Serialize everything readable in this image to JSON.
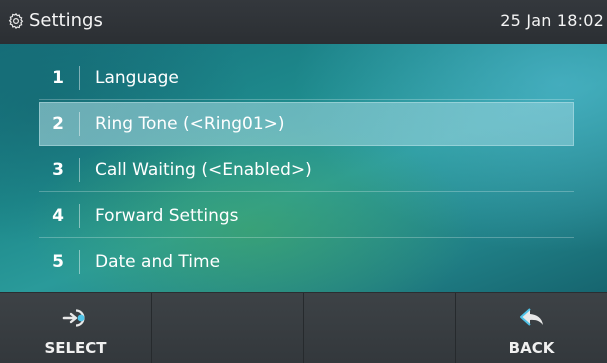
{
  "header": {
    "title": "Settings",
    "datetime": "25 Jan 18:02",
    "icon": "gear-icon"
  },
  "menu": {
    "selected_index": 1,
    "items": [
      {
        "number": "1",
        "label": "Language"
      },
      {
        "number": "2",
        "label": "Ring Tone (<Ring01>)"
      },
      {
        "number": "3",
        "label": "Call Waiting (<Enabled>)"
      },
      {
        "number": "4",
        "label": "Forward Settings"
      },
      {
        "number": "5",
        "label": "Date and Time"
      }
    ]
  },
  "softkeys": {
    "select_label": "SELECT",
    "select_icon": "select-arrow-icon",
    "back_label": "BACK",
    "back_icon": "back-arrow-icon"
  },
  "colors": {
    "header_bg": "#2f3337",
    "softkey_bg": "#383d41",
    "selected_row": "#a8d8e0",
    "back_icon_accent": "#4fc3e8"
  }
}
